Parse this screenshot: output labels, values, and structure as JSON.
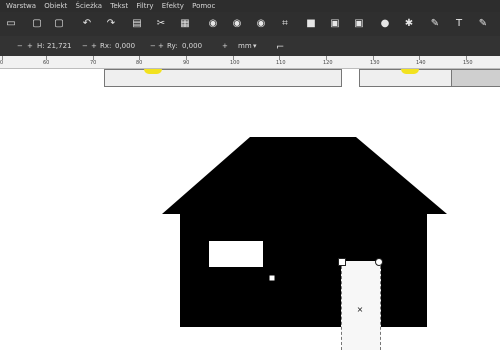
{
  "menu": [
    "Warstwa",
    "Obiekt",
    "Ścieżka",
    "Tekst",
    "Filtry",
    "Efekty",
    "Pomoc"
  ],
  "toolbar_icons": [
    "print-icon",
    "import-icon",
    "export-icon",
    "undo-icon",
    "redo-icon",
    "copy-icon",
    "cut-icon",
    "paste-icon",
    "zoom-selection-icon",
    "zoom-drawing-icon",
    "zoom-page-icon",
    "zoom-fit-icon",
    "duplicate-icon",
    "clone-icon",
    "unlink-clone-icon",
    "group-icon",
    "ungroup-icon",
    "node-editor-icon",
    "text-tool-icon",
    "paint-icon"
  ],
  "controls": {
    "height_label": "H:",
    "height_value": "21,721",
    "rx_label": "Rx:",
    "rx_value": "0,000",
    "ry_label": "Ry:",
    "ry_value": "0,000",
    "unit": "mm",
    "minus": "−",
    "plus": "+"
  },
  "ruler": {
    "labels": [
      "0",
      "60",
      "70",
      "80",
      "90",
      "100",
      "110",
      "120",
      "130",
      "140",
      "150"
    ]
  }
}
